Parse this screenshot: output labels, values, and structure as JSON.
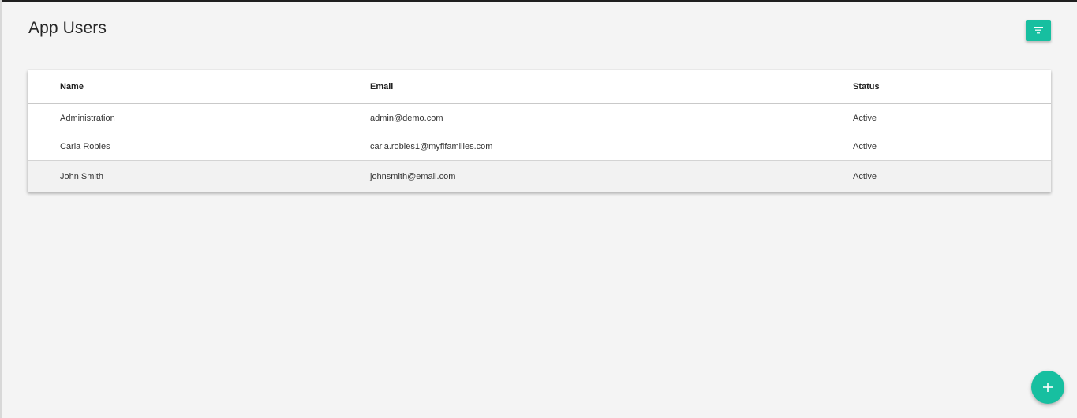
{
  "page": {
    "title": "App Users"
  },
  "toolbar": {
    "filter_icon": "filter-icon"
  },
  "table": {
    "columns": [
      "Name",
      "Email",
      "Status"
    ],
    "rows": [
      {
        "name": "Administration",
        "email": "admin@demo.com",
        "status": "Active"
      },
      {
        "name": "Carla Robles",
        "email": "carla.robles1@myflfamilies.com",
        "status": "Active"
      },
      {
        "name": "John Smith",
        "email": "johnsmith@email.com",
        "status": "Active"
      }
    ]
  },
  "fab": {
    "icon": "plus-icon"
  },
  "colors": {
    "accent": "#17bfa0",
    "background": "#f4f4f4",
    "hover_row": "#f2f2f2"
  }
}
